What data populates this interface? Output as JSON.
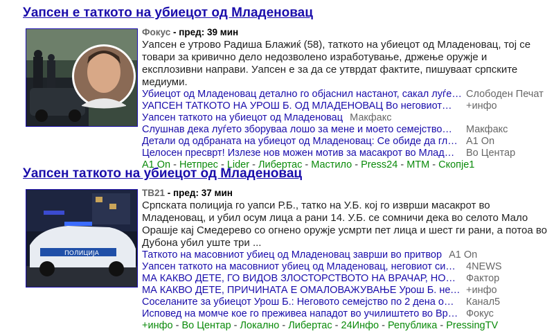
{
  "stories": [
    {
      "title": "Уапсен е таткото на убиецот од Младеновац",
      "source": "Фокус",
      "time": "- пред: 39 мин",
      "snippet": "Уапсен е утрово Радиша Блажиќ (58), таткото на убиецот од Младеновац, тој се товари за кривично дело недозволено изработување, држење оружје и експлозивни направи. Уапсен е за да се утврдат фактите, пишуваат српските медиуми.",
      "related": [
        {
          "text": "Убиецот од Младеновац детално го објаснил настанот, сакал луѓе",
          "source": "Слободен Печат",
          "truncated": true
        },
        {
          "text": "УАПСЕН ТАТКОТО НА УРОШ Б. ОД МЛАДЕНОВАЦ Во неговиот",
          "source": "+инфо",
          "truncated": true
        },
        {
          "text": "Уапсен таткото на убиецот од Младеновац",
          "source": "Макфакс",
          "truncated": false
        },
        {
          "text": "Слушнав дека луѓето зборуваа лошо за мене и моето семејство",
          "source": "Макфакс",
          "truncated": true
        },
        {
          "text": "Детали од одбраната на убиецот од Младеновац: Се обиде да гл",
          "source": "А1 Оn",
          "truncated": true
        },
        {
          "text": "Целосен пресврт! Излезе нов можен мотив за масакрот во Млад",
          "source": "Во Центар",
          "truncated": true
        }
      ],
      "sources": [
        "А1 Оn",
        "Нетпрес",
        "Lider",
        "Либертас",
        "Мастило",
        "Press24",
        "МТМ",
        "Скопје1"
      ]
    },
    {
      "title": "Уапсен таткото на убиецот од Младеновац",
      "source": "ТВ21",
      "time": "- пред: 37 мин",
      "snippet": "Српската полиција го уапси Р.Б., татко на У.Б. кој го изврши масакрот во Младеновац, и убил осум лица а рани 14. У.Б. се сомничи дека во селото Мало Орашје кај Смедерево со огнено оружје усмрти пет лица и шест ги рани, а потоа во Дубона убил уште три ...",
      "related": [
        {
          "text": "Таткото на масовниот убиец од Младеновац заврши во притвор",
          "source": "А1 Оn",
          "truncated": false
        },
        {
          "text": "Уапсен таткото на масовниот убиец од Младеновац, неговиот си",
          "source": "4NEWS",
          "truncated": true
        },
        {
          "text": "МА КАКВО ДЕТЕ, ГО ВИДОВ ЗЛОСТОРСТВОТО НА ВРАЧАР, НО",
          "source": "Фактор",
          "truncated": true
        },
        {
          "text": "МА КАКВО ДЕТЕ, ПРИЧИНАТА Е ОМАЛОВАЖУВАЊЕ Урош Б. не",
          "source": "+инфо",
          "truncated": true
        },
        {
          "text": "Соселаните за убиецот Урош Б.: Неговото семејство по 2 дена о",
          "source": "Канал5",
          "truncated": true
        },
        {
          "text": "Исповед на момче кое го преживеа нападот во училиштето во Вр",
          "source": "Фокус",
          "truncated": true
        }
      ],
      "sources": [
        "+инфо",
        "Во Центар",
        "Локално",
        "Либертас",
        "24Инфо",
        "Република",
        "PressingTV"
      ]
    }
  ]
}
